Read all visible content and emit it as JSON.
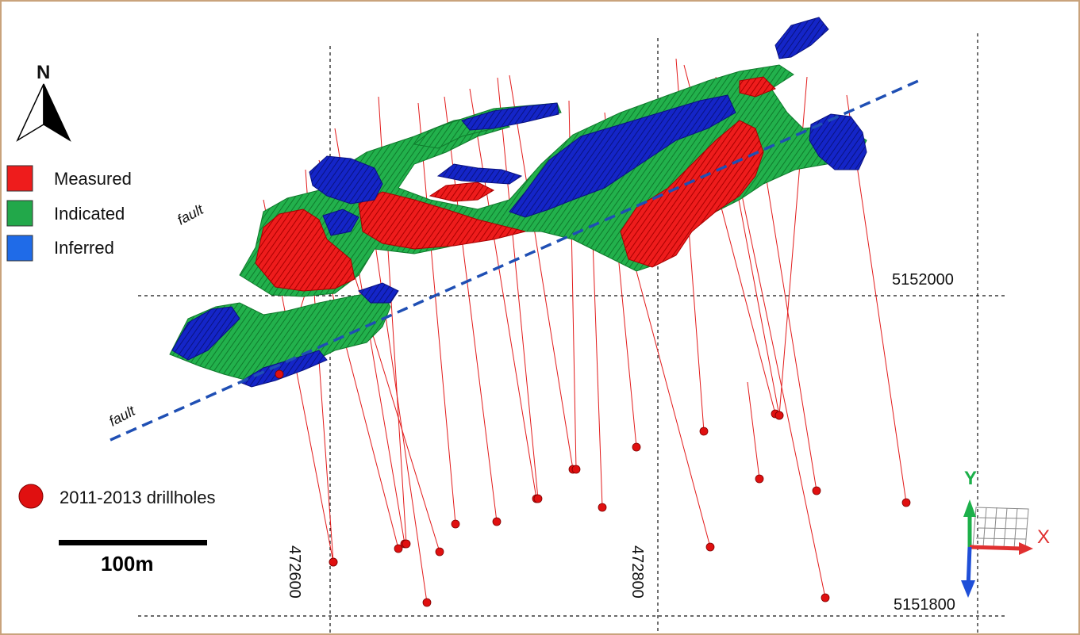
{
  "north_arrow": {
    "label": "N",
    "icon": "north-arrow-icon"
  },
  "legend": {
    "items": [
      {
        "label": "Measured",
        "color": "#ee1c1c"
      },
      {
        "label": "Indicated",
        "color": "#22a84a"
      },
      {
        "label": "Inferred",
        "color": "#1f6be8"
      }
    ]
  },
  "drillholes": {
    "label": "2011-2013 drillholes",
    "color": "#e01010"
  },
  "scale_bar": {
    "label": "100m"
  },
  "grid": {
    "eastings": [
      "472600",
      "472800"
    ],
    "northings": [
      "5152000",
      "5151800"
    ]
  },
  "faults": {
    "labels": [
      "fault",
      "fault"
    ],
    "color": "#1f4fb4"
  },
  "axes": {
    "x": "X",
    "y": "Y",
    "x_color": "#e03030",
    "y_color": "#1db04a",
    "z_color": "#1f4fd8"
  },
  "colors": {
    "measured": "#ee1c1c",
    "indicated": "#22b14c",
    "inferred": "#1425c8",
    "drill_trace": "#e21b1b",
    "border": "#c9a37c"
  }
}
